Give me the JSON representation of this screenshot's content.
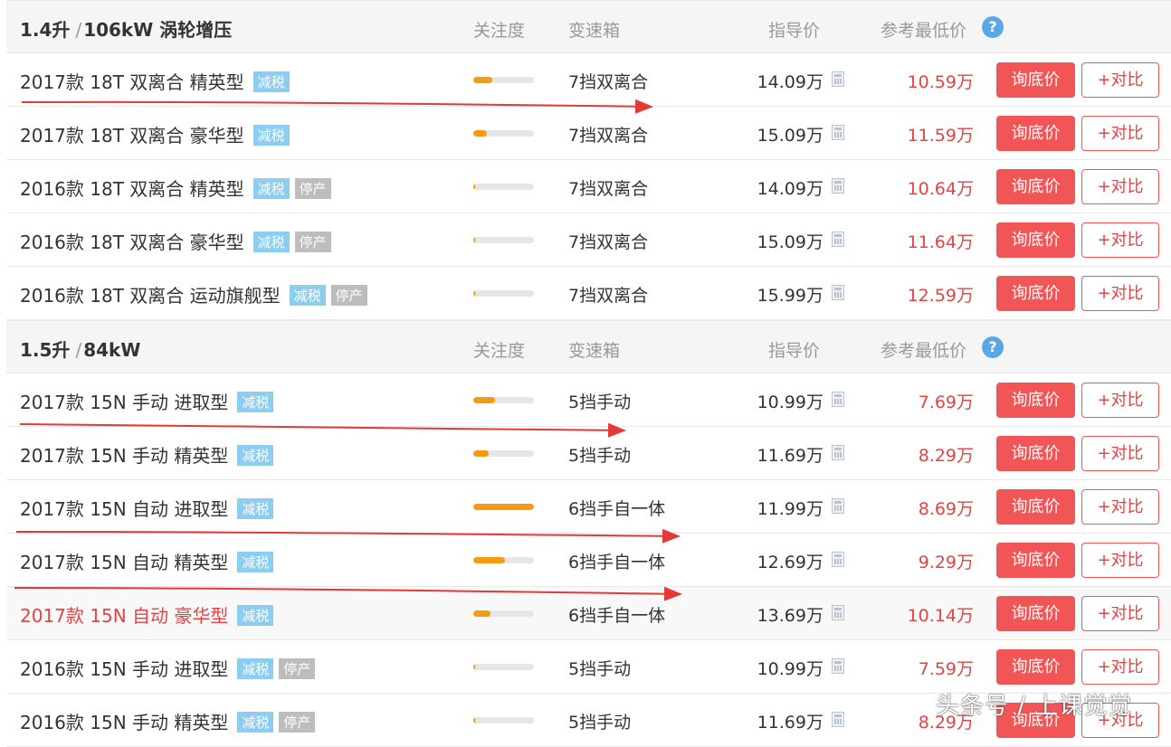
{
  "headers": {
    "attention": "关注度",
    "gearbox": "变速箱",
    "guide_price": "指导价",
    "ref_price": "参考最低价",
    "help_icon": "?"
  },
  "buttons": {
    "ask": "询底价",
    "compare": "+对比"
  },
  "tags": {
    "tax": "减税",
    "stopped": "停产"
  },
  "groups": [
    {
      "engine": "1.4升",
      "power": "106kW 涡轮增压",
      "sep": "/",
      "rows": [
        {
          "name": "2017款 18T 双离合 精英型",
          "tax": true,
          "stopped": false,
          "attention": 0.32,
          "gearbox": "7挡双离合",
          "guide": "14.09万",
          "ref": "10.59万",
          "red": false,
          "hl": false
        },
        {
          "name": "2017款 18T 双离合 豪华型",
          "tax": true,
          "stopped": false,
          "attention": 0.22,
          "gearbox": "7挡双离合",
          "guide": "15.09万",
          "ref": "11.59万",
          "red": false,
          "hl": false
        },
        {
          "name": "2016款 18T 双离合 精英型",
          "tax": true,
          "stopped": true,
          "attention": 0.03,
          "gearbox": "7挡双离合",
          "guide": "14.09万",
          "ref": "10.64万",
          "red": false,
          "hl": false
        },
        {
          "name": "2016款 18T 双离合 豪华型",
          "tax": true,
          "stopped": true,
          "attention": 0.03,
          "gearbox": "7挡双离合",
          "guide": "15.09万",
          "ref": "11.64万",
          "red": false,
          "hl": false
        },
        {
          "name": "2016款 18T 双离合 运动旗舰型",
          "tax": true,
          "stopped": true,
          "attention": 0.02,
          "gearbox": "7挡双离合",
          "guide": "15.99万",
          "ref": "12.59万",
          "red": false,
          "hl": false
        }
      ]
    },
    {
      "engine": "1.5升",
      "power": "84kW",
      "sep": "/",
      "rows": [
        {
          "name": "2017款 15N 手动 进取型",
          "tax": true,
          "stopped": false,
          "attention": 0.36,
          "gearbox": "5挡手动",
          "guide": "10.99万",
          "ref": "7.69万",
          "red": false,
          "hl": false
        },
        {
          "name": "2017款 15N 手动 精英型",
          "tax": true,
          "stopped": false,
          "attention": 0.25,
          "gearbox": "5挡手动",
          "guide": "11.69万",
          "ref": "8.29万",
          "red": false,
          "hl": false
        },
        {
          "name": "2017款 15N 自动 进取型",
          "tax": true,
          "stopped": false,
          "attention": 1.0,
          "gearbox": "6挡手自一体",
          "guide": "11.99万",
          "ref": "8.69万",
          "red": false,
          "hl": false
        },
        {
          "name": "2017款 15N 自动 精英型",
          "tax": true,
          "stopped": false,
          "attention": 0.52,
          "gearbox": "6挡手自一体",
          "guide": "12.69万",
          "ref": "9.29万",
          "red": false,
          "hl": false
        },
        {
          "name": "2017款 15N 自动 豪华型",
          "tax": true,
          "stopped": false,
          "attention": 0.28,
          "gearbox": "6挡手自一体",
          "guide": "13.69万",
          "ref": "10.14万",
          "red": true,
          "hl": true
        },
        {
          "name": "2016款 15N 手动 进取型",
          "tax": true,
          "stopped": true,
          "attention": 0.02,
          "gearbox": "5挡手动",
          "guide": "10.99万",
          "ref": "7.59万",
          "red": false,
          "hl": false
        },
        {
          "name": "2016款 15N 手动 精英型",
          "tax": true,
          "stopped": true,
          "attention": 0.02,
          "gearbox": "5挡手动",
          "guide": "11.69万",
          "ref": "8.29万",
          "red": false,
          "hl": false
        }
      ]
    }
  ],
  "watermark": "头条号 / 上课觉觉",
  "annotation_color": "#e53935"
}
